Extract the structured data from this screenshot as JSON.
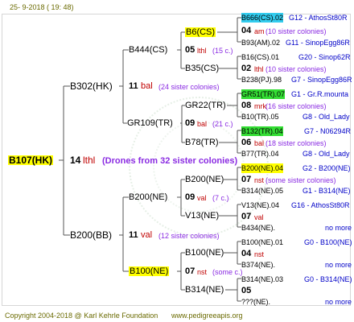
{
  "header": {
    "date": "25-  9-2018 ( 19:  48)"
  },
  "footer": {
    "copyright": "Copyright 2004-2018 @ Karl Kehrle Foundation",
    "site": "www.pedigreeapis.org"
  },
  "root": {
    "name": "B107(HK)",
    "gen": "14",
    "mark": "lthl",
    "note": "(Drones from 32 sister colonies)"
  },
  "g1": [
    {
      "name": "B302(HK)",
      "gen": "11",
      "mark": "bal",
      "note": "(24 sister colonies)"
    },
    {
      "name": "B200(BB)",
      "gen": "11",
      "mark": "val",
      "note": "(12 sister colonies)"
    }
  ],
  "g2": [
    {
      "name": "B444(CS)",
      "gen": "05",
      "mark": "lthl",
      "note": "(15 c.)"
    },
    {
      "name": "GR109(TR)",
      "gen": "09",
      "mark": "bal",
      "note": "(21 c.)"
    },
    {
      "name": "B200(NE)",
      "gen": "09",
      "mark": "val",
      "note": "(7 c.)"
    },
    {
      "name": "B100(NE)",
      "gen": "07",
      "mark": "nst",
      "note": "(some c.)"
    }
  ],
  "g3": [
    {
      "name": "B6(CS)"
    },
    {
      "name": "B35(CS)"
    },
    {
      "name": "GR22(TR)"
    },
    {
      "name": "B78(TR)"
    },
    {
      "name": "B200(NE)"
    },
    {
      "name": "V13(NE)"
    },
    {
      "name": "B100(NE)"
    },
    {
      "name": "B314(NE)"
    }
  ],
  "g4": [
    {
      "name": "B666(CS).02",
      "code": "G12 - AthosSt80R",
      "gen": "04",
      "mark": "am",
      "note": "(10 sister colonies)",
      "pat": "B93(AM).02",
      "patcode": "G11 - SinopEgg86R"
    },
    {
      "name": "B16(CS).01",
      "code": "G20 - Sinop62R",
      "gen": "02",
      "mark": "lthl",
      "note": "(10 sister colonies)",
      "pat": "B238(PJ).98",
      "patcode": "G7 - SinopEgg86R"
    },
    {
      "name": "GR51(TR).07",
      "code": "G1 - Gr.R.mounta",
      "gen": "08",
      "mrk": "mrk",
      "mark": "mrk",
      "note": "(16 sister colonies)",
      "pat": "B10(TR).05",
      "patcode": "G8 - Old_Lady"
    },
    {
      "name": "B132(TR).04",
      "code": "G7 - N06294R",
      "gen": "06",
      "mark": "bal",
      "note": "(18 sister colonies)",
      "pat": "B77(TR).04",
      "patcode": "G8 - Old_Lady"
    },
    {
      "name": "B200(NE).04",
      "code": "G2 - B200(NE)",
      "gen": "07",
      "mark": "nst",
      "note": "(some sister colonies)",
      "pat": "B314(NE).05",
      "patcode": "G1 - B314(NE)"
    },
    {
      "name": "V13(NE).04",
      "code": "G16 - AthosSt80R",
      "gen": "07",
      "mark": "val",
      "note": "",
      "pat": "B434(NE).",
      "patcode": "no more"
    },
    {
      "name": "B100(NE).01",
      "code": "G0 - B100(NE)",
      "gen": "04",
      "mark": "nst",
      "note": "",
      "pat": "B374(NE).",
      "patcode": "no more"
    },
    {
      "name": "B314(NE).03",
      "code": "G0 - B314(NE)",
      "gen": "05",
      "mark": "",
      "note": "",
      "pat": "???(NE).",
      "patcode": "no more"
    }
  ]
}
